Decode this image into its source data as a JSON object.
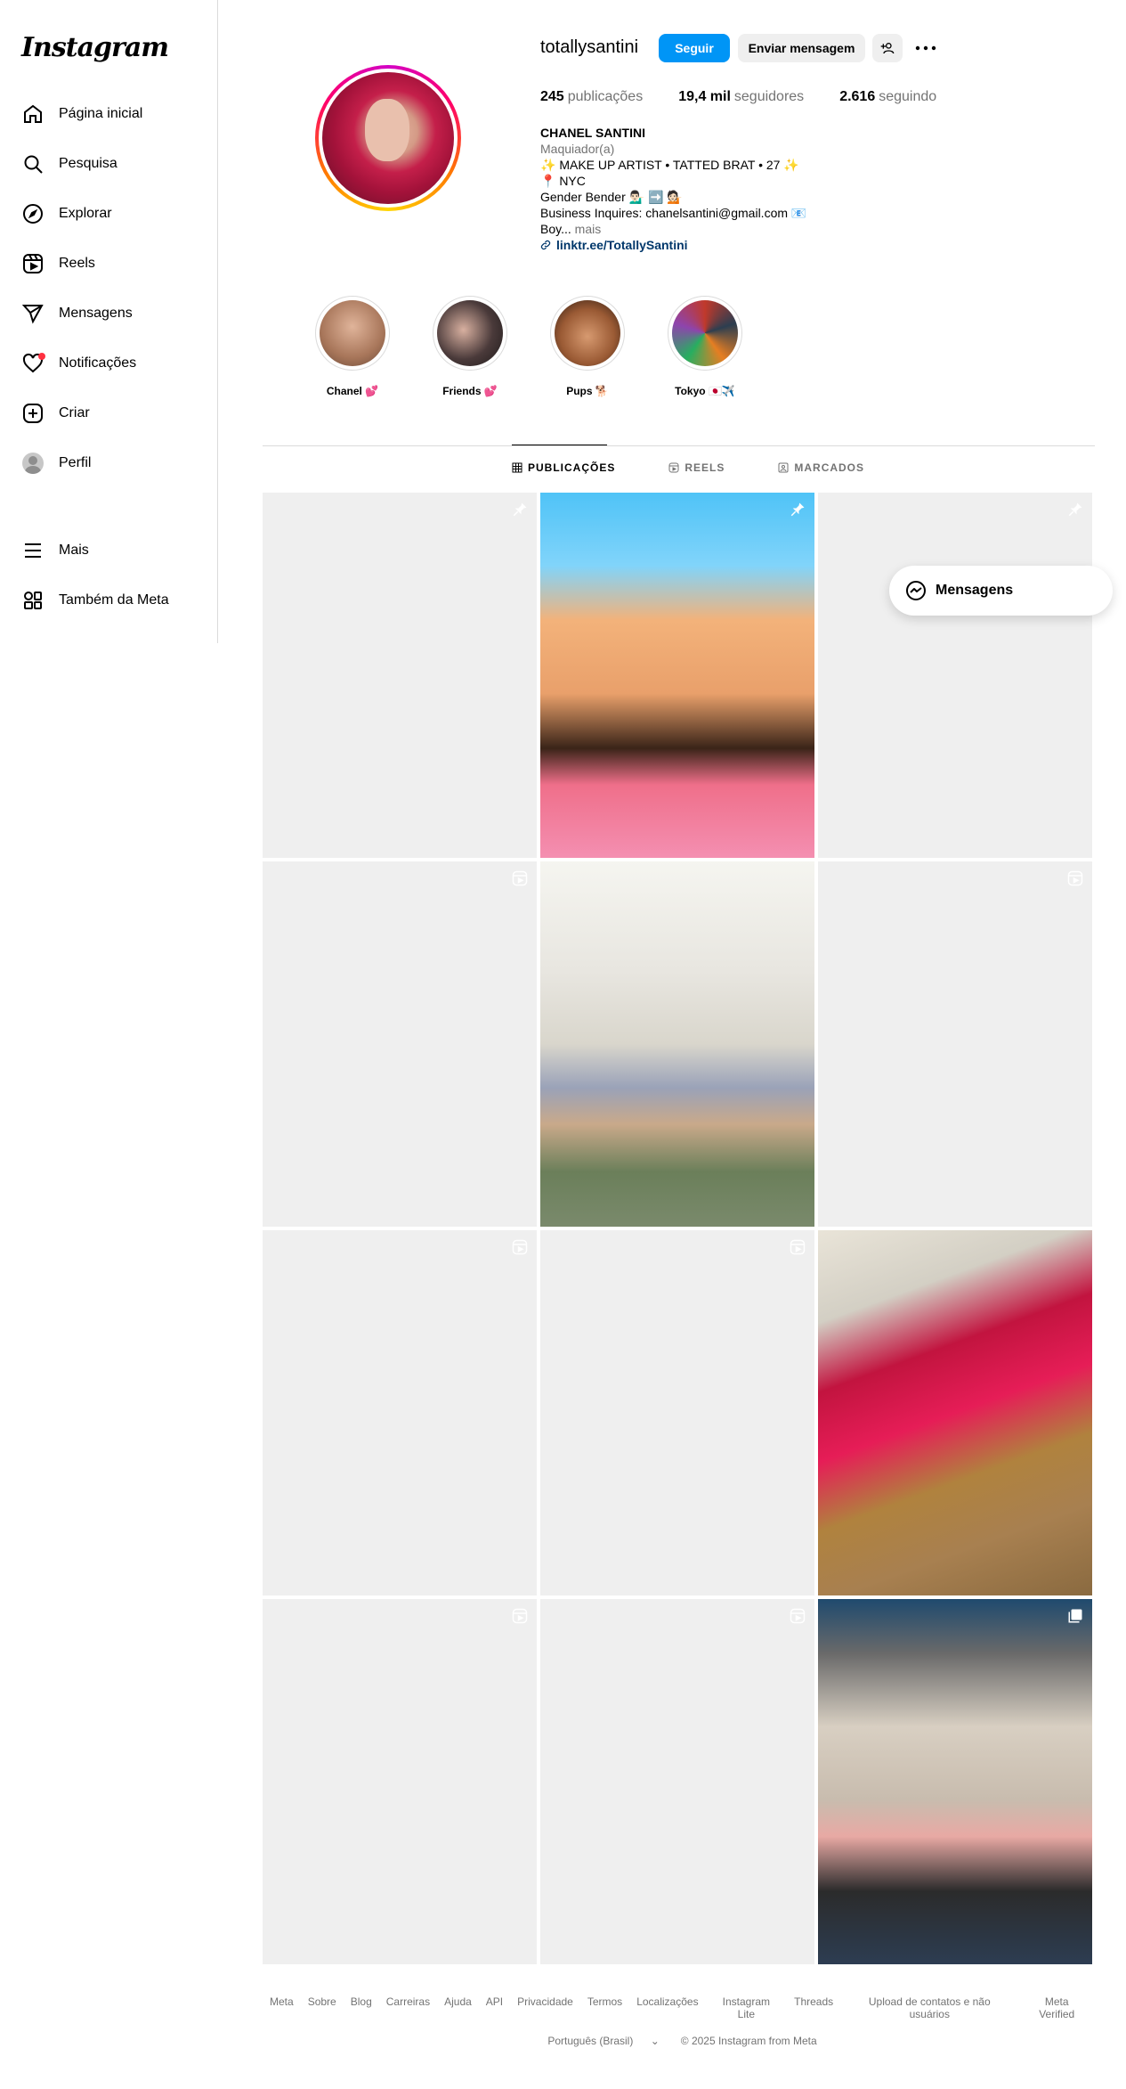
{
  "app": {
    "logo_text": "Instagram"
  },
  "sidebar": {
    "items": [
      {
        "label": "Página inicial",
        "icon": "home-icon"
      },
      {
        "label": "Pesquisa",
        "icon": "search-icon"
      },
      {
        "label": "Explorar",
        "icon": "compass-icon"
      },
      {
        "label": "Reels",
        "icon": "reels-icon"
      },
      {
        "label": "Mensagens",
        "icon": "send-icon"
      },
      {
        "label": "Notificações",
        "icon": "heart-icon"
      },
      {
        "label": "Criar",
        "icon": "plus-square-icon"
      },
      {
        "label": "Perfil",
        "icon": "avatar"
      }
    ],
    "bottom": [
      {
        "label": "Mais",
        "icon": "menu-icon"
      },
      {
        "label": "Também da Meta",
        "icon": "meta-apps-icon"
      }
    ]
  },
  "profile": {
    "username": "totallysantini",
    "follow_label": "Seguir",
    "message_label": "Enviar mensagem",
    "stats": {
      "posts_count": "245",
      "posts_label": "publicações",
      "followers_count": "19,4 mil",
      "followers_label": "seguidores",
      "following_count": "2.616",
      "following_label": "seguindo"
    },
    "bio": {
      "name": "CHANEL SANTINI",
      "category": "Maquiador(a)",
      "line1": "✨ MAKE UP ARTIST • TATTED BRAT • 27 ✨",
      "line2": "📍 NYC",
      "line3": "Gender Bender 💁🏻‍♂️ ➡️ 💁🏻",
      "line4": "Business Inquires: chanelsantini@gmail.com 📧",
      "line5": "Boy...",
      "more": " mais",
      "link": "linktr.ee/TotallySantini"
    }
  },
  "highlights": [
    {
      "label": "Chanel 💕",
      "color": "#c48a6a"
    },
    {
      "label": "Friends 💕",
      "color": "#3a3a3a"
    },
    {
      "label": "Pups 🐕",
      "color": "#8a4a2a"
    },
    {
      "label": "Tokyo 🇯🇵✈️",
      "color": "#c0392b"
    }
  ],
  "tabs": [
    {
      "label": "PUBLICAÇÕES",
      "icon": "grid-icon",
      "active": true
    },
    {
      "label": "REELS",
      "icon": "reels-icon",
      "active": false
    },
    {
      "label": "MARCADOS",
      "icon": "tagged-icon",
      "active": false
    }
  ],
  "posts": [
    {
      "kind": "empty",
      "badge": "pin-icon"
    },
    {
      "kind": "cartoon",
      "badge": "pin-icon"
    },
    {
      "kind": "empty",
      "badge": "pin-icon"
    },
    {
      "kind": "empty",
      "badge": "reel-icon"
    },
    {
      "kind": "group",
      "badge": ""
    },
    {
      "kind": "empty",
      "badge": "reel-icon"
    },
    {
      "kind": "empty",
      "badge": "reel-icon"
    },
    {
      "kind": "empty",
      "badge": "reel-icon"
    },
    {
      "kind": "red",
      "badge": ""
    },
    {
      "kind": "empty",
      "badge": "reel-icon"
    },
    {
      "kind": "empty",
      "badge": "reel-icon"
    },
    {
      "kind": "blonde",
      "badge": "carousel-icon"
    }
  ],
  "floating_messages": {
    "label": "Mensagens"
  },
  "footer": {
    "links": [
      "Meta",
      "Sobre",
      "Blog",
      "Carreiras",
      "Ajuda",
      "API",
      "Privacidade",
      "Termos",
      "Localizações",
      "Instagram Lite",
      "Threads",
      "Upload de contatos e não usuários",
      "Meta Verified"
    ],
    "language": "Português (Brasil)",
    "copyright": "© 2025 Instagram from Meta"
  }
}
